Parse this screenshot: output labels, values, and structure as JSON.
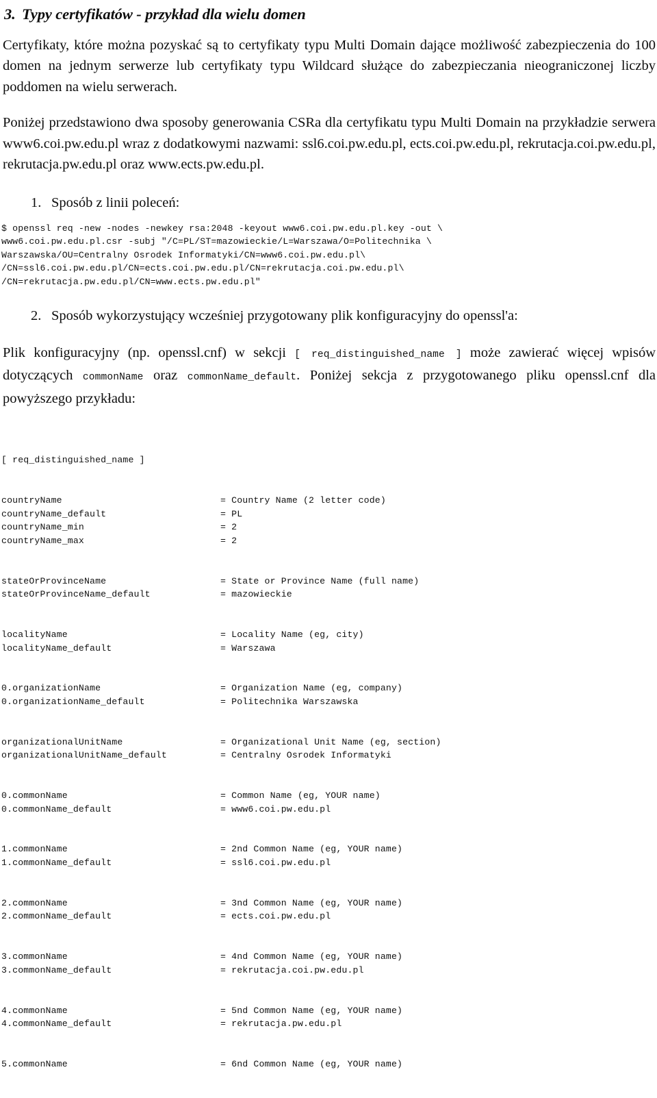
{
  "document": {
    "heading": {
      "number": "3.",
      "text": "Typy certyfikatów - przykład dla wielu domen"
    },
    "paragraph_intro": "Certyfikaty, które można pozyskać są to certyfikaty typu Multi Domain dające możliwość zabezpieczenia do 100 domen na jednym serwerze lub certyfikaty typu Wildcard służące do zabezpieczania nieograniczonej liczby poddomen na wielu serwerach.",
    "paragraph_second": "Poniżej przedstawiono dwa sposoby generowania CSRa dla certyfikatu typu Multi Domain na przykładzie serwera www6.coi.pw.edu.pl wraz z dodatkowymi nazwami:  ssl6.coi.pw.edu.pl, ects.coi.pw.edu.pl, rekrutacja.coi.pw.edu.pl, rekrutacja.pw.edu.pl oraz www.ects.pw.edu.pl.",
    "step_1": {
      "number": "1.",
      "text": "Sposób z linii poleceń:"
    },
    "command_block": "$ openssl req -new -nodes -newkey rsa:2048 -keyout www6.coi.pw.edu.pl.key -out \\\nwww6.coi.pw.edu.pl.csr -subj \"/C=PL/ST=mazowieckie/L=Warszawa/O=Politechnika \\\nWarszawska/OU=Centralny Osrodek Informatyki/CN=www6.coi.pw.edu.pl\\\n/CN=ssl6.coi.pw.edu.pl/CN=ects.coi.pw.edu.pl/CN=rekrutacja.coi.pw.edu.pl\\\n/CN=rekrutacja.pw.edu.pl/CN=www.ects.pw.edu.pl\"",
    "step_2": {
      "number": "2.",
      "text": "Sposób wykorzystujący wcześniej przygotowany plik konfiguracyjny do openssl'a:"
    },
    "paragraph_third": {
      "part_1": "Plik  konfiguracyjny  (np.  openssl.cnf)  w  sekcji",
      "mono_1": "[  req_distinguished_name  ]",
      "part_2": "może zawierać więcej wpisów dotyczących",
      "mono_2": "commonName",
      "part_3": "oraz",
      "mono_3": "commonName_default",
      "part_4": ". Poniżej sekcja z przygotowanego pliku openssl.cnf dla powyższego przykładu:"
    },
    "config_section_header": "[ req_distinguished_name ]",
    "config_rows": [
      {
        "key": "countryName",
        "value": "= Country Name (2 letter code)"
      },
      {
        "key": "countryName_default",
        "value": "= PL"
      },
      {
        "key": "countryName_min",
        "value": "= 2"
      },
      {
        "key": "countryName_max",
        "value": "= 2"
      },
      {
        "key": "",
        "value": ""
      },
      {
        "key": "",
        "value": ""
      },
      {
        "key": "stateOrProvinceName",
        "value": "= State or Province Name (full name)"
      },
      {
        "key": "stateOrProvinceName_default",
        "value": "= mazowieckie"
      },
      {
        "key": "",
        "value": ""
      },
      {
        "key": "",
        "value": ""
      },
      {
        "key": "localityName",
        "value": "= Locality Name (eg, city)"
      },
      {
        "key": "localityName_default",
        "value": "= Warszawa"
      },
      {
        "key": "",
        "value": ""
      },
      {
        "key": "",
        "value": ""
      },
      {
        "key": "0.organizationName",
        "value": "= Organization Name (eg, company)"
      },
      {
        "key": "0.organizationName_default",
        "value": "= Politechnika Warszawska"
      },
      {
        "key": "",
        "value": ""
      },
      {
        "key": "",
        "value": ""
      },
      {
        "key": "organizationalUnitName",
        "value": "= Organizational Unit Name (eg, section)"
      },
      {
        "key": "organizationalUnitName_default",
        "value": "= Centralny Osrodek Informatyki"
      },
      {
        "key": "",
        "value": ""
      },
      {
        "key": "",
        "value": ""
      },
      {
        "key": "0.commonName",
        "value": "= Common Name (eg, YOUR name)"
      },
      {
        "key": "0.commonName_default",
        "value": "= www6.coi.pw.edu.pl"
      },
      {
        "key": "",
        "value": ""
      },
      {
        "key": "",
        "value": ""
      },
      {
        "key": "1.commonName",
        "value": "= 2nd Common Name (eg, YOUR name)"
      },
      {
        "key": "1.commonName_default",
        "value": "= ssl6.coi.pw.edu.pl"
      },
      {
        "key": "",
        "value": ""
      },
      {
        "key": "",
        "value": ""
      },
      {
        "key": "2.commonName",
        "value": "= 3nd Common Name (eg, YOUR name)"
      },
      {
        "key": "2.commonName_default",
        "value": "= ects.coi.pw.edu.pl"
      },
      {
        "key": "",
        "value": ""
      },
      {
        "key": "",
        "value": ""
      },
      {
        "key": "3.commonName",
        "value": "= 4nd Common Name (eg, YOUR name)"
      },
      {
        "key": "3.commonName_default",
        "value": "= rekrutacja.coi.pw.edu.pl"
      },
      {
        "key": "",
        "value": ""
      },
      {
        "key": "",
        "value": ""
      },
      {
        "key": "4.commonName",
        "value": "= 5nd Common Name (eg, YOUR name)"
      },
      {
        "key": "4.commonName_default",
        "value": "= rekrutacja.pw.edu.pl"
      },
      {
        "key": "",
        "value": ""
      },
      {
        "key": "",
        "value": ""
      },
      {
        "key": "5.commonName",
        "value": "= 6nd Common Name (eg, YOUR name)"
      }
    ]
  }
}
